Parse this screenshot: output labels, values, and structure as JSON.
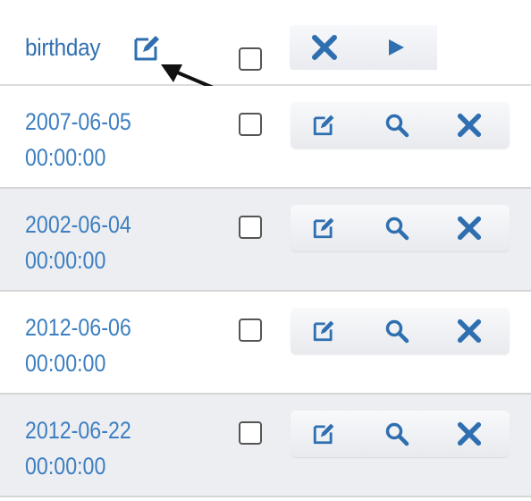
{
  "column": {
    "title": "birthday",
    "edit_icon": "edit-icon"
  },
  "header_actions": {
    "icons": [
      "close-icon",
      "play-icon"
    ]
  },
  "rows": [
    {
      "date": "2007-06-05",
      "time": "00:00:00",
      "icons": [
        "edit-icon",
        "search-icon",
        "close-icon"
      ]
    },
    {
      "date": "2002-06-04",
      "time": "00:00:00",
      "icons": [
        "edit-icon",
        "search-icon",
        "close-icon"
      ]
    },
    {
      "date": "2012-06-06",
      "time": "00:00:00",
      "icons": [
        "edit-icon",
        "search-icon",
        "close-icon"
      ]
    },
    {
      "date": "2012-06-22",
      "time": "00:00:00",
      "icons": [
        "edit-icon",
        "search-icon",
        "close-icon"
      ]
    }
  ],
  "colors": {
    "accent": "#2f6fb0",
    "date_text": "#3d7fc0",
    "stripe": "#edeef2",
    "arrow": "#111111"
  }
}
